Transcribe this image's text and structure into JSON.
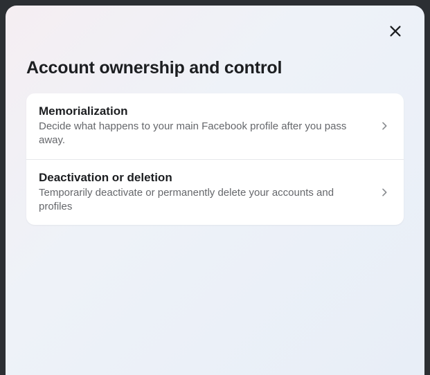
{
  "modal": {
    "title": "Account ownership and control",
    "options": [
      {
        "title": "Memorialization",
        "description": "Decide what happens to your main Facebook profile after you pass away."
      },
      {
        "title": "Deactivation or deletion",
        "description": "Temporarily deactivate or permanently delete your accounts and profiles"
      }
    ]
  }
}
